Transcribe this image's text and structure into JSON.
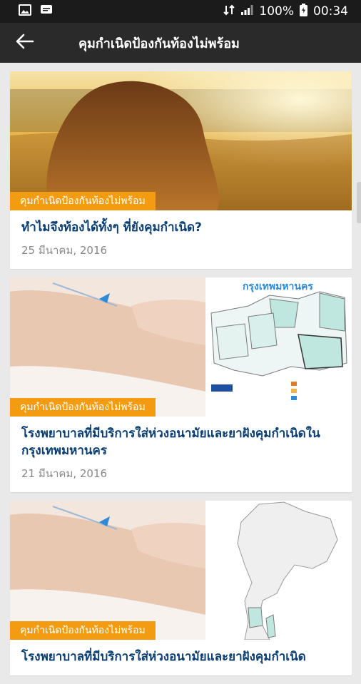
{
  "status_bar": {
    "battery": "100%",
    "time": "00:34",
    "icons": [
      "image-icon",
      "message-icon",
      "sync-icon",
      "signal-icon",
      "battery-icon"
    ]
  },
  "toolbar": {
    "title": "คุมกำเนิดป้องกันท้องไม่พร้อม",
    "back_icon": "arrow-left-icon"
  },
  "articles": [
    {
      "tag": "คุมกำเนิดป้องกันท้องไม่พร้อม",
      "title": "ทำไมจึงท้องได้ทั้งๆ ที่ยังคุมกำเนิด?",
      "date": "25 มีนาคม, 2016"
    },
    {
      "tag": "คุมกำเนิดป้องกันท้องไม่พร้อม",
      "title": "โรงพยาบาลที่มีบริการใส่ห่วงอนามัยและยาฝังคุมกำเนิดในกรุงเทพมหานคร",
      "date": "21 มีนาคม, 2016",
      "map_title": "กรุงเทพมหานคร"
    },
    {
      "tag": "คุมกำเนิดป้องกันท้องไม่พร้อม",
      "title": "โรงพยาบาลที่มีบริการใส่ห่วงอนามัยและยาฝังคุมกำเนิด"
    }
  ],
  "colors": {
    "accent": "#f39c12",
    "title_blue": "#0b3f73",
    "toolbar": "#2a2a2a"
  }
}
